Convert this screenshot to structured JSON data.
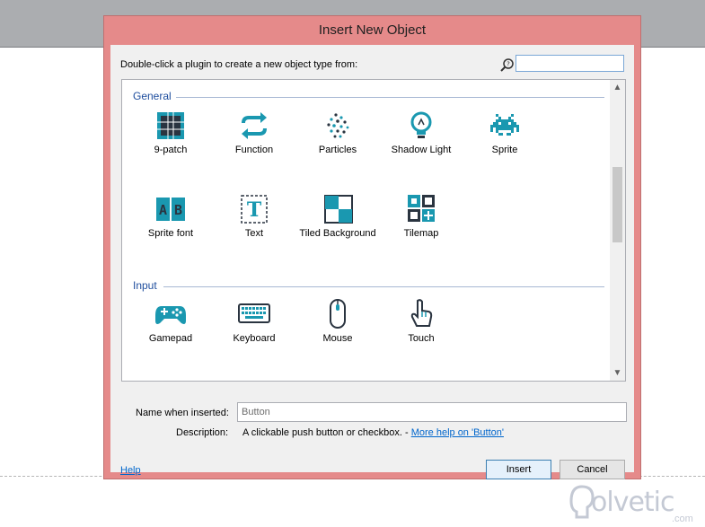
{
  "dialog": {
    "title": "Insert New Object",
    "prompt": "Double-click a plugin to create a new object type from:",
    "search_placeholder": "",
    "categories": [
      {
        "name": "General",
        "items": [
          "9-patch",
          "Function",
          "Particles",
          "Shadow Light",
          "Sprite",
          "Sprite font",
          "Text",
          "Tiled Background",
          "Tilemap"
        ]
      },
      {
        "name": "Input",
        "items": [
          "Gamepad",
          "Keyboard",
          "Mouse",
          "Touch"
        ]
      }
    ],
    "name_label": "Name when inserted:",
    "name_value": "Button",
    "description_label": "Description:",
    "description_text": "A clickable push button or checkbox. - ",
    "description_link": "More help on 'Button'",
    "help_link": "Help",
    "insert_button": "Insert",
    "cancel_button": "Cancel"
  },
  "watermark": {
    "text": "olvetic",
    "sub": ".com"
  },
  "colors": {
    "accent": "#1a98b0",
    "dark": "#2a3440",
    "title_bg": "#e58a8a",
    "category": "#1f4e9e"
  }
}
